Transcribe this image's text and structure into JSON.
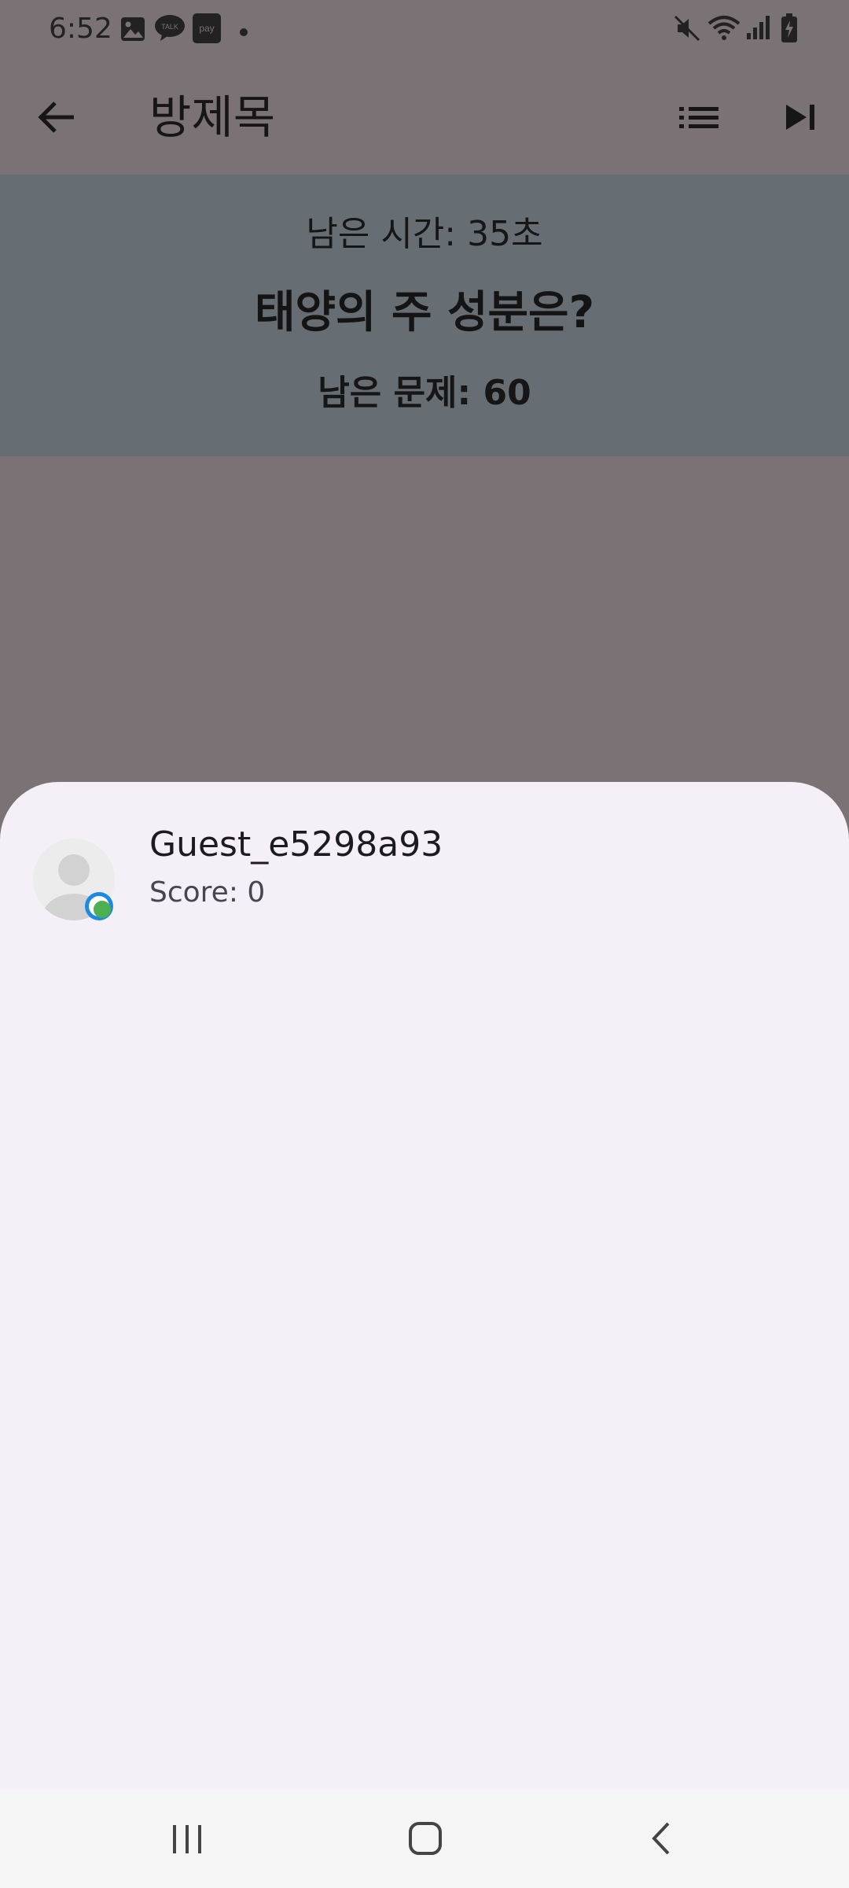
{
  "status_bar": {
    "time": "6:52",
    "notification_icons": [
      "gallery-icon",
      "talk-icon",
      "pay-icon",
      "dot-icon"
    ],
    "talk_label": "TALK",
    "pay_label": "pay",
    "system_icons": [
      "mute-icon",
      "wifi-icon",
      "signal-icon",
      "battery-icon"
    ]
  },
  "app_bar": {
    "title": "방제목",
    "back_icon": "arrow-back-icon",
    "list_icon": "list-icon",
    "skip_icon": "skip-next-icon"
  },
  "question": {
    "time_left": "남은 시간: 35초",
    "text": "태양의 주 성분은?",
    "remaining": "남은 문제: 60"
  },
  "players": [
    {
      "name": "Guest_e5298a93",
      "score": "Score: 0",
      "online": true
    }
  ],
  "nav_bar": {
    "icons": [
      "recent-apps-icon",
      "home-icon",
      "back-icon"
    ]
  },
  "colors": {
    "scrim_background": "#7a7275",
    "question_panel": "#666d73",
    "sheet_background": "#f5f0f7",
    "online_badge": "#4caf50",
    "badge_ring": "#1e88e5"
  }
}
